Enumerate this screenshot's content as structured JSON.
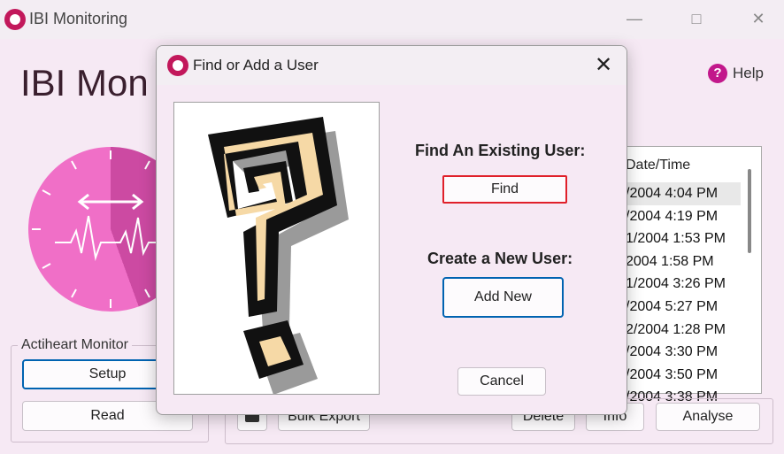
{
  "app": {
    "title": "IBI Monitoring",
    "heading": "IBI Mon",
    "minimize_icon": "minimize-icon",
    "maximize_icon": "maximize-icon",
    "close_icon": "close-icon",
    "help_label": "Help"
  },
  "actiheart": {
    "group_label": "Actiheart Monitor",
    "setup_label": "Setup",
    "read_label": "Read"
  },
  "records": {
    "header": "Date/Time",
    "rows": [
      "/2004 4:04 PM",
      "/2004 4:19 PM",
      "1/2004 1:53 PM",
      "2004 1:58 PM",
      "1/2004 3:26 PM",
      "/2004 5:27 PM",
      "2/2004 1:28 PM",
      "/2004 3:30 PM",
      "/2004 3:50 PM",
      "/2004 3:38 PM"
    ],
    "selected_index": 0
  },
  "toolbar": {
    "bulk_export_label": "Bulk Export",
    "delete_label": "Delete",
    "info_label": "Info",
    "analyse_label": "Analyse"
  },
  "dialog": {
    "title": "Find or Add a User",
    "find_heading": "Find An Existing User:",
    "find_label": "Find",
    "create_heading": "Create a New User:",
    "add_new_label": "Add New",
    "cancel_label": "Cancel"
  },
  "colors": {
    "accent": "#c2185b",
    "find_highlight": "#e0202a",
    "focus": "#0063b1"
  }
}
